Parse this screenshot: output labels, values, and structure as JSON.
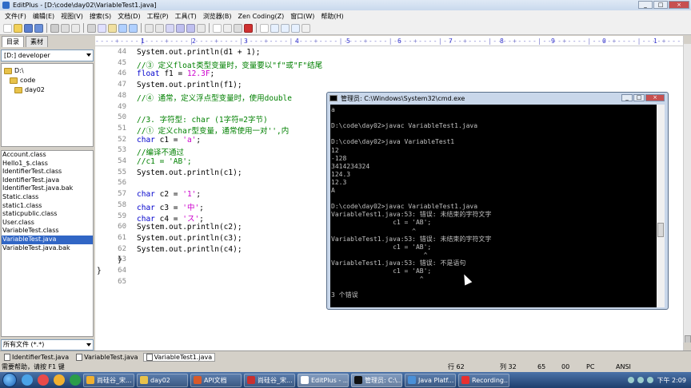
{
  "window": {
    "title": "EditPlus - [D:\\code\\day02\\VariableTest1.java]",
    "buttons": [
      "_",
      "□",
      "×"
    ]
  },
  "menu": [
    "文件(F)",
    "编辑(E)",
    "视图(V)",
    "搜索(S)",
    "文档(D)",
    "工程(P)",
    "工具(T)",
    "浏览器(B)",
    "Zen Coding(Z)",
    "窗口(W)",
    "帮助(H)"
  ],
  "sidebar": {
    "tabs": [
      "目录",
      "素材"
    ],
    "drive": "[D:] developer",
    "folders": [
      "D:\\",
      "code",
      "day02"
    ],
    "files": [
      "Account.class",
      "Hello1_$.class",
      "IdentifierTest.class",
      "IdentifierTest.java",
      "IdentifierTest.java.bak",
      "Static.class",
      "static1.class",
      "staticpublic.class",
      "User.class",
      "VariableTest.class",
      "VariableTest.java",
      "VariableTest.java.bak"
    ],
    "selected_file_index": 10,
    "filter": "所有文件 (*.*)"
  },
  "ruler": {
    "digits": [
      "1",
      "2",
      "3",
      "4",
      "5",
      "6",
      "7",
      "8",
      "9",
      "0",
      "1"
    ]
  },
  "editor": {
    "line_numbers": [
      "44",
      "45",
      "46",
      "47",
      "48",
      "49",
      "50",
      "51",
      "52",
      "53",
      "54",
      "55",
      "56",
      "57",
      "58",
      "59",
      "60",
      "61",
      "62",
      "63",
      "64",
      "65"
    ],
    "lines": [
      [
        {
          "t": "pl",
          "v": "System"
        },
        {
          "t": "pl",
          "v": ".out.println(d1 + 1);"
        }
      ],
      [
        {
          "t": "cm",
          "v": "//③ 定义float类型变量时，变量要以\"f\"或\"F\"结尾"
        }
      ],
      [
        {
          "t": "kw",
          "v": "float"
        },
        {
          "t": "pl",
          "v": " f1 = "
        },
        {
          "t": "st",
          "v": "12.3F"
        },
        {
          "t": "pl",
          "v": ";"
        }
      ],
      [
        {
          "t": "pl",
          "v": "System"
        },
        {
          "t": "pl",
          "v": ".out.println(f1);"
        }
      ],
      [
        {
          "t": "cm",
          "v": "//④ 通常，定义浮点型变量时，使用double"
        }
      ],
      [],
      [
        {
          "t": "cm",
          "v": "//3. 字符型: char (1字符=2字节)"
        }
      ],
      [
        {
          "t": "cm",
          "v": "//① 定义char型变量，通常使用一对'',内"
        }
      ],
      [
        {
          "t": "kw",
          "v": "char"
        },
        {
          "t": "pl",
          "v": " c1 = "
        },
        {
          "t": "st",
          "v": "'a'"
        },
        {
          "t": "pl",
          "v": ";"
        }
      ],
      [
        {
          "t": "cm",
          "v": "//编译不通过"
        }
      ],
      [
        {
          "t": "cm",
          "v": "//c1 = 'AB';"
        }
      ],
      [
        {
          "t": "pl",
          "v": "System"
        },
        {
          "t": "pl",
          "v": ".out.println(c1);"
        }
      ],
      [],
      [
        {
          "t": "kw",
          "v": "char"
        },
        {
          "t": "pl",
          "v": " c2 = "
        },
        {
          "t": "st",
          "v": "'1'"
        },
        {
          "t": "pl",
          "v": ";"
        }
      ],
      [
        {
          "t": "kw",
          "v": "char"
        },
        {
          "t": "pl",
          "v": " c3 = "
        },
        {
          "t": "st",
          "v": "'中'"
        },
        {
          "t": "pl",
          "v": ";"
        }
      ],
      [
        {
          "t": "kw",
          "v": "char"
        },
        {
          "t": "pl",
          "v": " c4 = "
        },
        {
          "t": "st",
          "v": "'ス'"
        },
        {
          "t": "pl",
          "v": ";"
        }
      ],
      [
        {
          "t": "pl",
          "v": "System"
        },
        {
          "t": "pl",
          "v": ".out.println(c2);"
        }
      ],
      [
        {
          "t": "pl",
          "v": "System"
        },
        {
          "t": "pl",
          "v": ".out.println(c3);"
        }
      ],
      [
        {
          "t": "pl",
          "v": "System"
        },
        {
          "t": "pl",
          "v": ".out.println(c4);"
        }
      ],
      [
        {
          "t": "pl",
          "v": "}"
        }
      ],
      [
        {
          "t": "pl",
          "v": "}"
        }
      ],
      []
    ]
  },
  "cmd": {
    "title": "管理员: C:\\Windows\\System32\\cmd.exe",
    "lines": [
      "a",
      "",
      "D:\\code\\day02>javac VariableTest1.java",
      "",
      "D:\\code\\day02>java VariableTest1",
      "12",
      "-128",
      "3414234324",
      "124.3",
      "12.3",
      "A",
      "",
      "D:\\code\\day02>javac VariableTest1.java",
      "VariableTest1.java:53: 错误: 未结束的字符文字",
      "                c1 = 'AB';",
      "                     ^",
      "VariableTest1.java:53: 错误: 未结束的字符文字",
      "                c1 = 'AB';",
      "                        ^",
      "VariableTest1.java:53: 错误: 不是语句",
      "                c1 = 'AB';",
      "                       ^",
      "",
      "3 个错误",
      "",
      "D:\\code\\day02>"
    ]
  },
  "doc_tabs": [
    "IdentifierTest.java",
    "VariableTest.java",
    "VariableTest1.java"
  ],
  "status": {
    "help": "需要帮助，请按 F1 键",
    "row": "行 62",
    "col": "列 32",
    "num": "65",
    "c00": "00",
    "pc": "PC",
    "enc": "ANSI"
  },
  "taskbar": {
    "tasks": [
      "尚硅谷_宋...",
      "day02",
      "API文档",
      "尚硅谷_宋...",
      "EditPlus - ...",
      "管理员: C:\\...",
      "Java Platf...",
      "Recording..."
    ],
    "clock": "下午 2:09"
  },
  "colors": {
    "keyword": "#0000cc",
    "comment": "#008000",
    "string": "#cc00cc",
    "selection": "#3166c5"
  }
}
